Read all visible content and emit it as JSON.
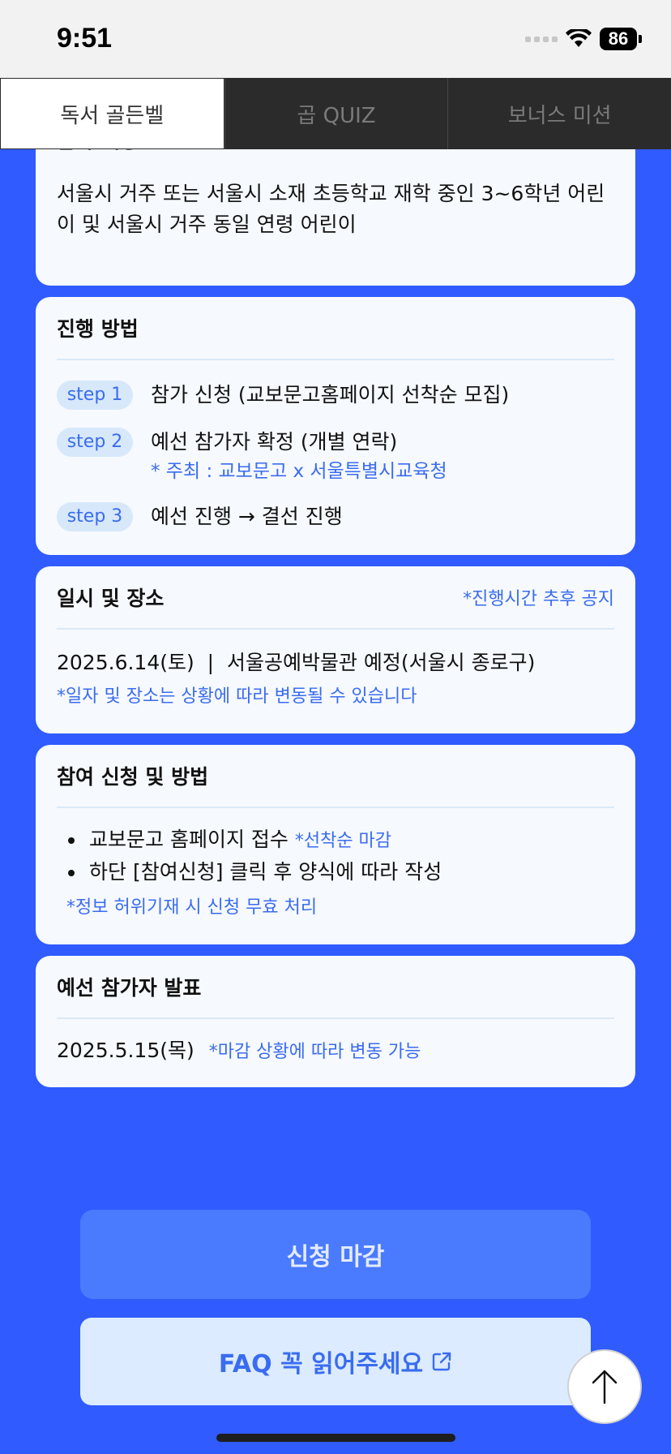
{
  "status": {
    "time": "9:51",
    "battery": "86"
  },
  "tabs": [
    {
      "label": "독서 골든벨",
      "active": true
    },
    {
      "label": "곱 QUIZ",
      "active": false
    },
    {
      "label": "보너스 미션",
      "active": false
    }
  ],
  "eligibility": {
    "title": "참가 대상",
    "body": "서울시 거주 또는 서울시 소재 초등학교 재학 중인 3~6학년 어린이 및 서울시 거주 동일 연령 어린이"
  },
  "process": {
    "title": "진행 방법",
    "steps": [
      {
        "label": "step 1",
        "text": "참가 신청 (교보문고홈페이지 선착순 모집)",
        "sub": ""
      },
      {
        "label": "step 2",
        "text": "예선 참가자 확정 (개별 연락)",
        "sub": "* 주최 : 교보문고 x 서울특별시교육청"
      },
      {
        "label": "step 3",
        "text": "예선 진행 → 결선 진행",
        "sub": ""
      }
    ]
  },
  "schedule": {
    "title": "일시 및 장소",
    "note": "*진행시간 추후 공지",
    "body": "2025.6.14(토)  |  서울공예박물관 예정(서울시 종로구)",
    "sub": "*일자 및 장소는 상황에 따라 변동될 수 있습니다"
  },
  "application": {
    "title": "참여 신청 및 방법",
    "items": [
      {
        "text": "교보문고 홈페이지 접수 ",
        "note": "*선착순 마감"
      },
      {
        "text": "하단 [참여신청] 클릭 후 양식에 따라 작성",
        "note": ""
      }
    ],
    "footnote": "*정보 허위기재 시 신청 무효 처리"
  },
  "announcement": {
    "title": "예선 참가자 발표",
    "date": "2025.5.15(목)",
    "note": "*마감 상황에 따라 변동 가능"
  },
  "buttons": {
    "apply_closed": "신청 마감",
    "faq": "FAQ 꼭 읽어주세요"
  },
  "colors": {
    "background": "#2f5bff",
    "accent": "#3a6cf0",
    "card": "#f6f9fe",
    "tab_bar": "#2b2b2b"
  }
}
